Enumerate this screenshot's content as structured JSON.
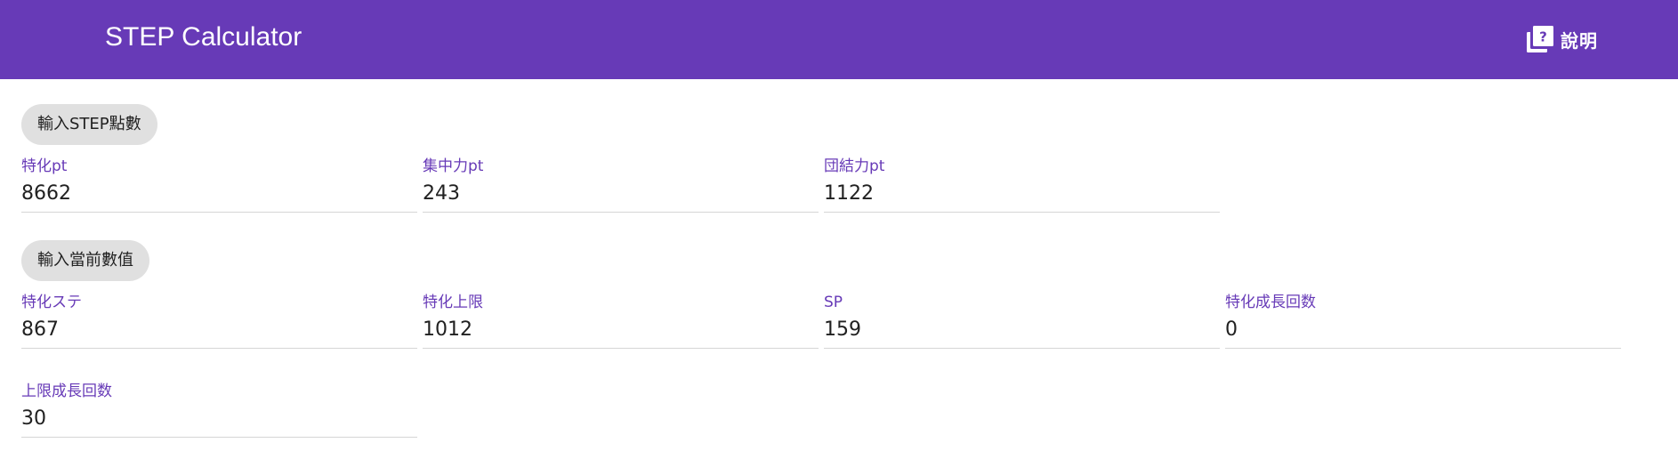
{
  "header": {
    "title": "STEP Calculator",
    "help_label": "說明",
    "help_icon_glyph": "?"
  },
  "sections": [
    {
      "chip": "輸入STEP點數",
      "fields": [
        {
          "label": "特化pt",
          "value": "8662"
        },
        {
          "label": "集中力pt",
          "value": "243"
        },
        {
          "label": "団結力pt",
          "value": "1122"
        }
      ]
    },
    {
      "chip": "輸入當前數值",
      "fields": [
        {
          "label": "特化ステ",
          "value": "867"
        },
        {
          "label": "特化上限",
          "value": "1012"
        },
        {
          "label": "SP",
          "value": "159"
        },
        {
          "label": "特化成長回数",
          "value": "0"
        },
        {
          "label": "上限成長回数",
          "value": "30"
        }
      ]
    }
  ],
  "colors": {
    "primary": "#673ab7",
    "chip_bg": "#e0e0e0",
    "underline": "#d6d6d6"
  }
}
